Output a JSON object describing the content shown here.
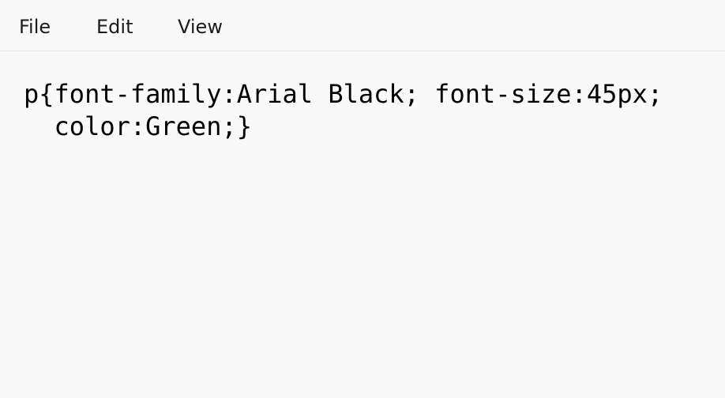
{
  "menu": {
    "file": "File",
    "edit": "Edit",
    "view": "View"
  },
  "editor": {
    "lines": [
      "p{font-family:Arial Black; font-size:45px;",
      "  color:Green;}"
    ]
  },
  "colors": {
    "background": "#f9f9f9",
    "text": "#000000"
  }
}
